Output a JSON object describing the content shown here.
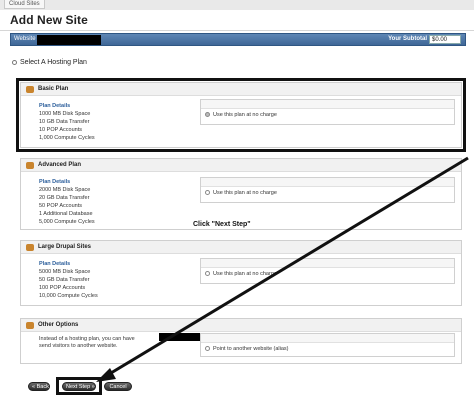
{
  "breadcrumb": {
    "tab": "Cloud Sites"
  },
  "header": {
    "title": "Add New Site"
  },
  "site_bar": {
    "website_label": "Website",
    "subtotal_label": "Your Subtotal",
    "subtotal_value": "$0.00"
  },
  "section": {
    "heading": "Select A Hosting Plan"
  },
  "plans": [
    {
      "name": "Basic Plan",
      "details_title": "Plan Details",
      "details": [
        "1000 MB Disk Space",
        "10 GB Data Transfer",
        "10 POP Accounts",
        "1,000 Compute Cycles"
      ],
      "option": "Use this plan at no charge",
      "selected": true
    },
    {
      "name": "Advanced Plan",
      "details_title": "Plan Details",
      "details": [
        "2000 MB Disk Space",
        "20 GB Data Transfer",
        "50 POP Accounts",
        "1 Additional Database",
        "5,000 Compute Cycles"
      ],
      "option": "Use this plan at no charge",
      "selected": false
    },
    {
      "name": "Large Drupal Sites",
      "details_title": "Plan Details",
      "details": [
        "5000 MB Disk Space",
        "50 GB Data Transfer",
        "100 POP Accounts",
        "10,000 Compute Cycles"
      ],
      "option": "Use this plan at no charge",
      "selected": false
    }
  ],
  "other": {
    "name": "Other Options",
    "text_1": "Instead of a hosting plan, you can have",
    "text_2": "send visitors to another website.",
    "option": "Point to another website (alias)"
  },
  "annotation": {
    "click_label": "Click \"Next Step\""
  },
  "buttons": {
    "back": "« Back",
    "next": "Next Step »",
    "cancel": "Cancel"
  },
  "colors": {
    "site_bar": "#4a72a2",
    "link": "#2a5d9a",
    "annotation": "#111111"
  },
  "icons": {
    "plan": "server-icon",
    "section": "radio-dot-icon"
  }
}
